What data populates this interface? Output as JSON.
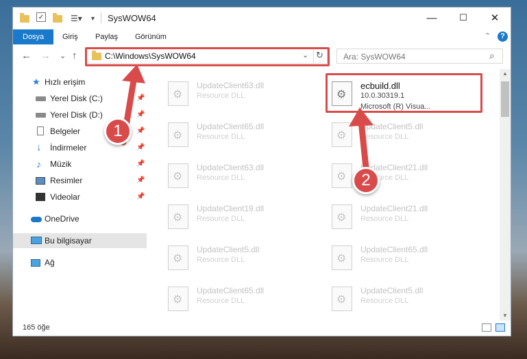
{
  "window": {
    "title": "SysWOW64",
    "controls": {
      "minimize": "—",
      "maximize": "☐",
      "close": "✕"
    }
  },
  "ribbon": {
    "tabs": [
      "Dosya",
      "Giriş",
      "Paylaş",
      "Görünüm"
    ],
    "active_tab": "Dosya",
    "help": "?",
    "collapse": "⌃"
  },
  "navigation": {
    "back": "←",
    "forward": "→",
    "recent": "⌄",
    "up": "↑",
    "address": "C:\\Windows\\SysWOW64",
    "address_dropdown": "⌄",
    "refresh": "↻",
    "search_placeholder": "Ara: SysWOW64",
    "search_icon": "⌕"
  },
  "sidebar": {
    "quick_access": "Hızlı erişim",
    "pinned": [
      {
        "label": "Yerel Disk (C:)",
        "icon": "drive-icon"
      },
      {
        "label": "Yerel Disk (D:)",
        "icon": "drive-icon"
      },
      {
        "label": "Belgeler",
        "icon": "document-icon"
      },
      {
        "label": "İndirmeler",
        "icon": "download-icon"
      },
      {
        "label": "Müzik",
        "icon": "music-icon"
      },
      {
        "label": "Resimler",
        "icon": "pictures-icon"
      },
      {
        "label": "Videolar",
        "icon": "video-icon"
      }
    ],
    "pin_glyph": "📌",
    "onedrive": "OneDrive",
    "this_pc": "Bu bilgisayar",
    "network": "Ağ"
  },
  "files": {
    "left_column": [
      {
        "name": "UpdateClient63.dll",
        "desc": "Resource DLL"
      },
      {
        "name": "UpdateClient65.dll",
        "desc": "Resource DLL"
      },
      {
        "name": "UpdateClient63.dll",
        "desc": "Resource DLL"
      },
      {
        "name": "UpdateClient19.dll",
        "desc": "Resource DLL"
      },
      {
        "name": "UpdateClient5.dll",
        "desc": "Resource DLL"
      },
      {
        "name": "UpdateClient65.dll",
        "desc": "Resource DLL"
      }
    ],
    "highlighted": {
      "name": "ecbuild.dll",
      "version": "10.0.30319.1",
      "company": "Microsoft (R) Visua..."
    },
    "right_column": [
      {
        "name": "UpdateClient5.dll",
        "desc": "Resource DLL"
      },
      {
        "name": "UpdateClient21.dll",
        "desc": "Resource DLL"
      },
      {
        "name": "UpdateClient21.dll",
        "desc": "Resource DLL"
      },
      {
        "name": "UpdateClient65.dll",
        "desc": "Resource DLL"
      },
      {
        "name": "UpdateClient5.dll",
        "desc": "Resource DLL"
      }
    ]
  },
  "status": {
    "count": "165 öğe"
  },
  "callouts": {
    "step1": "1",
    "step2": "2",
    "color": "#d94b4b"
  }
}
